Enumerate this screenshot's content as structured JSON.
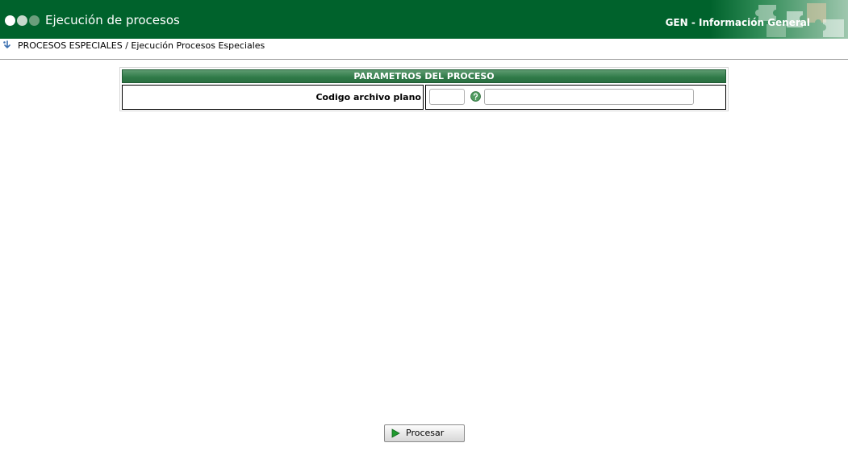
{
  "header": {
    "title": "Ejecución de procesos",
    "module": "GEN - Información General",
    "icons": [
      "dot-icon",
      "dot-icon",
      "dot-icon",
      "puzzle-image"
    ]
  },
  "breadcrumb": {
    "icon": "info-down-icon",
    "text": "PROCESOS ESPECIALES / Ejecución Procesos Especiales"
  },
  "params": {
    "title": "PARAMETROS DEL PROCESO",
    "field_label": "Codigo archivo plano",
    "code_value": "",
    "description_value": "",
    "help_icon": "help-icon"
  },
  "actions": {
    "process_label": "Procesar",
    "process_icon": "play-icon"
  },
  "colors": {
    "header_bg": "#00622c",
    "section_header": "#2f7a48"
  }
}
